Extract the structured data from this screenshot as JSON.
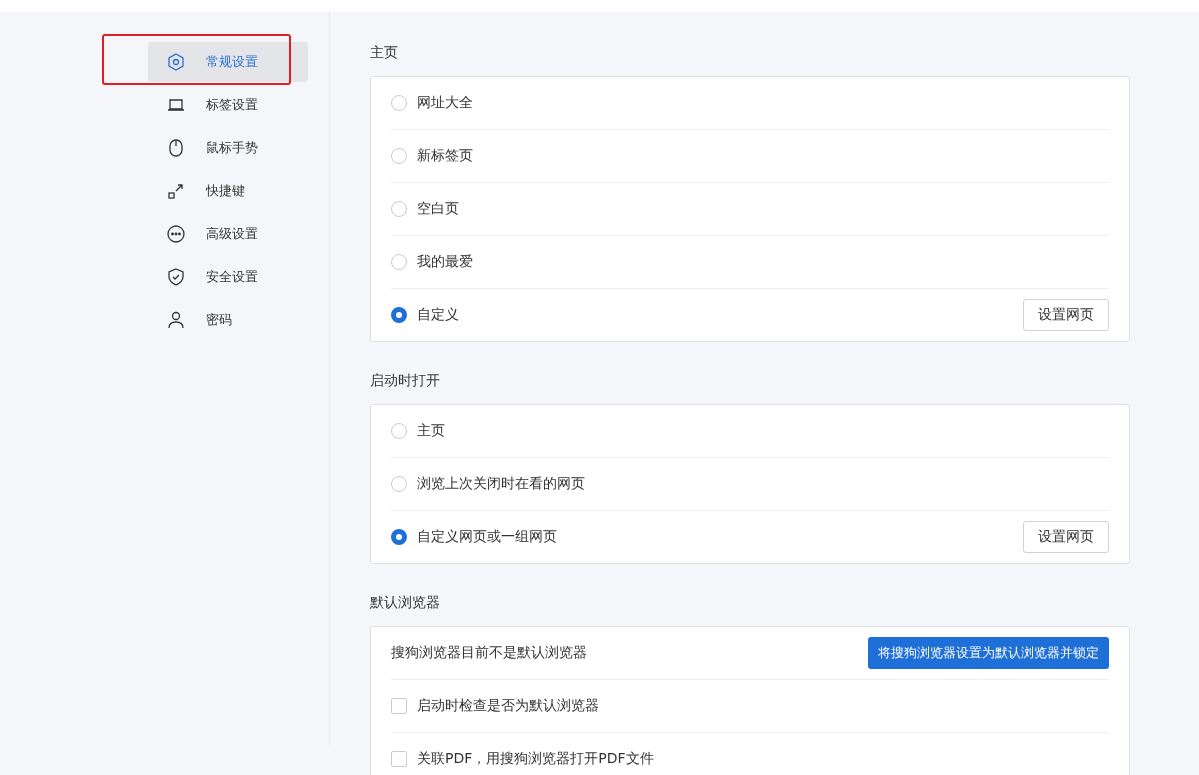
{
  "sidebar": {
    "items": [
      {
        "label": "常规设置",
        "selected": true,
        "highlighted": true
      },
      {
        "label": "标签设置",
        "selected": false,
        "highlighted": false
      },
      {
        "label": "鼠标手势",
        "selected": false,
        "highlighted": false
      },
      {
        "label": "快捷键",
        "selected": false,
        "highlighted": false
      },
      {
        "label": "高级设置",
        "selected": false,
        "highlighted": false
      },
      {
        "label": "安全设置",
        "selected": false,
        "highlighted": false
      },
      {
        "label": "密码",
        "selected": false,
        "highlighted": false
      }
    ]
  },
  "sections": [
    {
      "title": "主页",
      "rows": [
        {
          "kind": "radio",
          "label": "网址大全",
          "selected": false
        },
        {
          "kind": "radio",
          "label": "新标签页",
          "selected": false
        },
        {
          "kind": "radio",
          "label": "空白页",
          "selected": false
        },
        {
          "kind": "radio",
          "label": "我的最爱",
          "selected": false
        },
        {
          "kind": "radio",
          "label": "自定义",
          "selected": true,
          "button": "设置网页"
        }
      ]
    },
    {
      "title": "启动时打开",
      "rows": [
        {
          "kind": "radio",
          "label": "主页",
          "selected": false
        },
        {
          "kind": "radio",
          "label": "浏览上次关闭时在看的网页",
          "selected": false
        },
        {
          "kind": "radio",
          "label": "自定义网页或一组网页",
          "selected": true,
          "button": "设置网页"
        }
      ]
    },
    {
      "title": "默认浏览器",
      "rows": [
        {
          "kind": "text",
          "label": "搜狗浏览器目前不是默认浏览器",
          "primary_button": "将搜狗浏览器设置为默认浏览器并锁定"
        },
        {
          "kind": "checkbox",
          "label": "启动时检查是否为默认浏览器",
          "checked": false
        },
        {
          "kind": "checkbox",
          "label": "关联PDF，用搜狗浏览器打开PDF文件",
          "checked": false
        }
      ]
    }
  ]
}
